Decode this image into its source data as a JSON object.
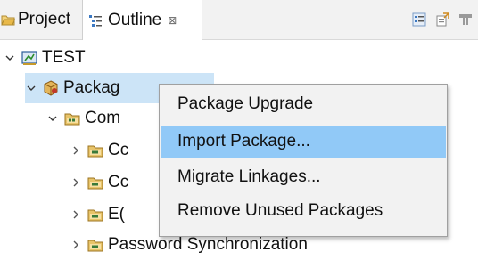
{
  "tabs": {
    "project": {
      "label": "Project"
    },
    "outline": {
      "label": "Outline",
      "close": "⊠"
    }
  },
  "toolbar": {
    "icons": [
      "collapse-all-icon",
      "link-editor-icon",
      "filter-icon"
    ]
  },
  "tree": {
    "items": [
      {
        "label": "TEST",
        "icon": "test-project-icon",
        "expanded": true
      },
      {
        "label": "Packag",
        "icon": "package-icon",
        "expanded": true,
        "selected": true
      },
      {
        "label": "Com",
        "icon": "folder-icon",
        "expanded": true
      },
      {
        "label": "Cc",
        "icon": "folder-icon",
        "expanded": false
      },
      {
        "label": "Cc",
        "icon": "folder-icon",
        "expanded": false
      },
      {
        "label": "E(",
        "icon": "folder-icon",
        "expanded": false
      },
      {
        "label": "Password Synchronization",
        "icon": "folder-icon",
        "expanded": false
      }
    ]
  },
  "context_menu": {
    "items": [
      {
        "label": "Package Upgrade"
      },
      {
        "label": "Import Package...",
        "highlighted": true
      },
      {
        "label": "Migrate Linkages..."
      },
      {
        "label": "Remove Unused Packages"
      }
    ]
  },
  "colors": {
    "selection": "#cce4f7",
    "menu_highlight": "#91c9f7",
    "menu_bg": "#f2f2f2"
  }
}
